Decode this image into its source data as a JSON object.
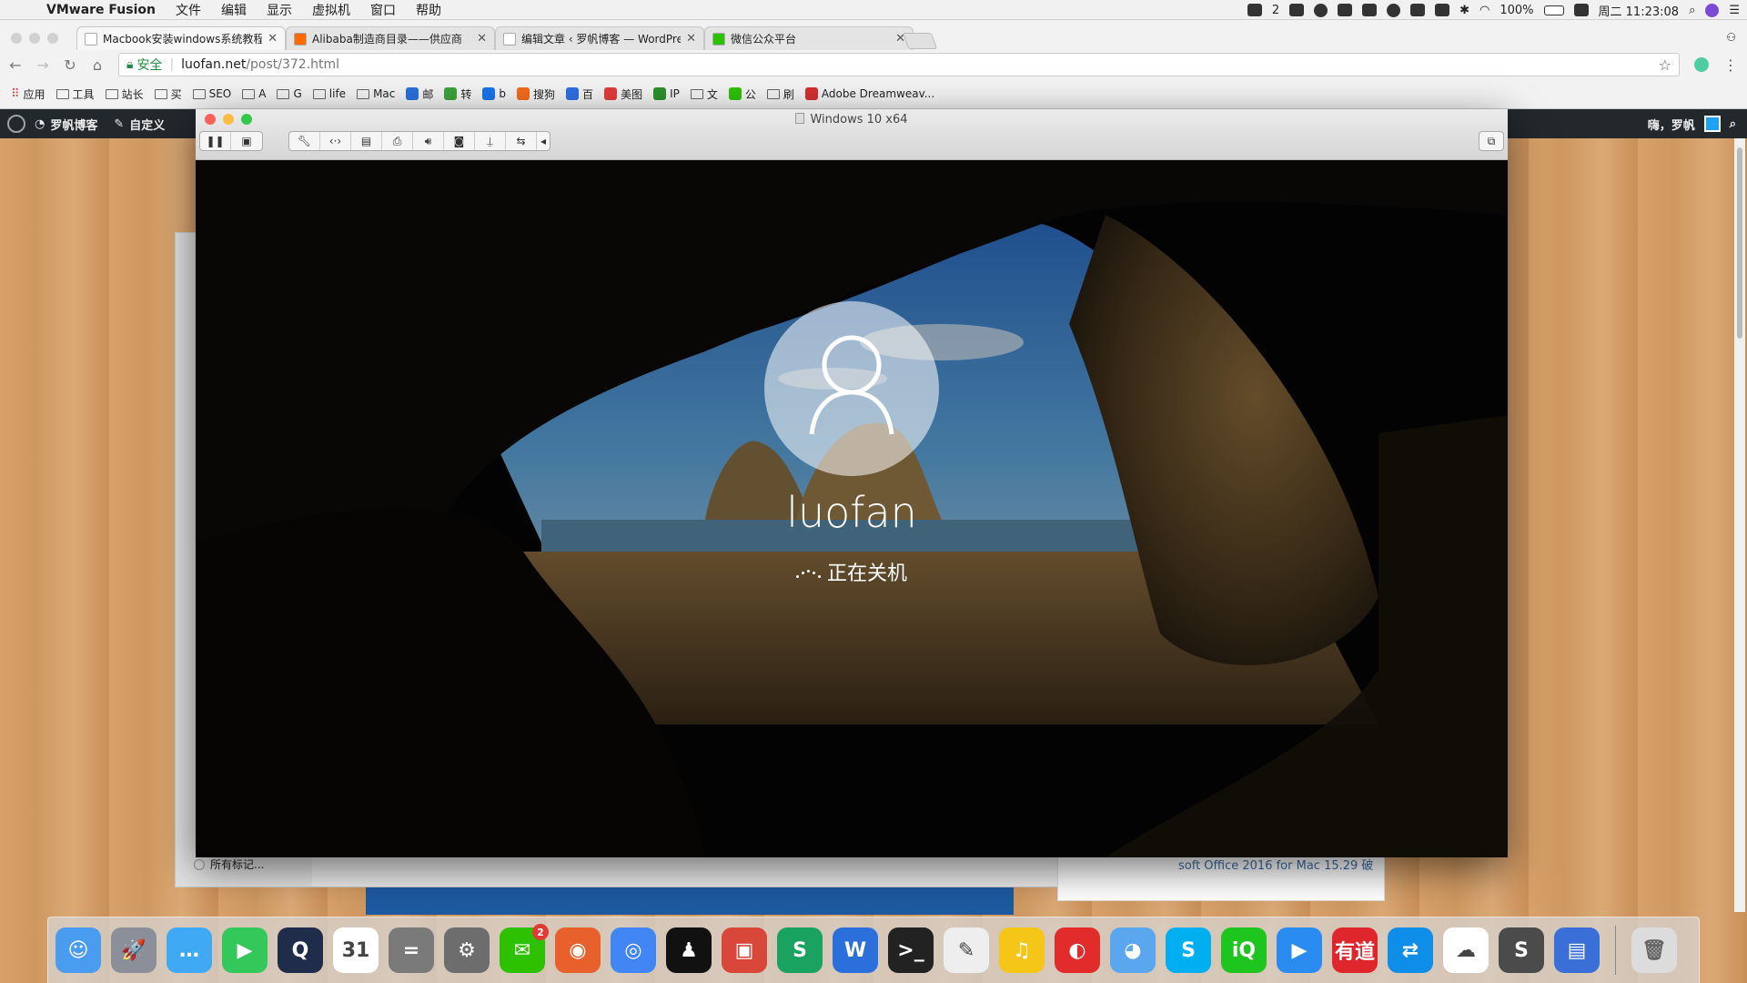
{
  "menubar": {
    "app": "VMware Fusion",
    "items": [
      "文件",
      "编辑",
      "显示",
      "虚拟机",
      "窗口",
      "帮助"
    ],
    "wechat_count": "2",
    "battery": "100%",
    "clock": "周二 11:23:08"
  },
  "browser": {
    "tabs": [
      {
        "title": "Macbook安装windows系统教程",
        "fav_color": "#ffffff",
        "active": true
      },
      {
        "title": "Alibaba制造商目录——供应商",
        "fav_color": "#ff6a00",
        "active": false
      },
      {
        "title": "编辑文章 ‹ 罗帆博客 — WordPress",
        "fav_color": "#ffffff",
        "active": false
      },
      {
        "title": "微信公众平台",
        "fav_color": "#2dc100",
        "active": false
      }
    ],
    "secure_label": "安全",
    "url_host": "luofan.net",
    "url_path": "/post/372.html",
    "bookmarks": [
      {
        "label": "应用",
        "kind": "apps"
      },
      {
        "label": "工具",
        "kind": "folder"
      },
      {
        "label": "站长",
        "kind": "folder"
      },
      {
        "label": "买",
        "kind": "folder"
      },
      {
        "label": "SEO",
        "kind": "folder"
      },
      {
        "label": "A",
        "kind": "folder"
      },
      {
        "label": "G",
        "kind": "folder"
      },
      {
        "label": "life",
        "kind": "folder"
      },
      {
        "label": "Mac",
        "kind": "folder"
      },
      {
        "label": "邮",
        "kind": "fav",
        "color": "#2a6fdb"
      },
      {
        "label": "转",
        "kind": "fav",
        "color": "#3aa33a"
      },
      {
        "label": "b",
        "kind": "fav",
        "color": "#1a73e8"
      },
      {
        "label": "搜狗",
        "kind": "fav",
        "color": "#f26b1d"
      },
      {
        "label": "百",
        "kind": "fav",
        "color": "#2f6fe4"
      },
      {
        "label": "美图",
        "kind": "fav",
        "color": "#e23b3b"
      },
      {
        "label": "IP",
        "kind": "fav",
        "color": "#2d8f2d"
      },
      {
        "label": "文",
        "kind": "folder"
      },
      {
        "label": "公",
        "kind": "fav",
        "color": "#2dc100"
      },
      {
        "label": "刷",
        "kind": "folder"
      },
      {
        "label": "Adobe Dreamweav...",
        "kind": "fav",
        "color": "#d32f2f"
      }
    ]
  },
  "wpbar": {
    "site": "罗帆博客",
    "customize": "自定义",
    "greeting": "嗨，罗帆"
  },
  "background": {
    "all_bookmarks": "所有标记...",
    "card_text": "soft Office 2016 for Mac 15.29 破"
  },
  "vm": {
    "window_title": "Windows 10 x64",
    "username": "luofan",
    "status": "正在关机"
  },
  "dock": {
    "apps": [
      {
        "name": "finder",
        "color": "#4a9cf0",
        "glyph": "☺"
      },
      {
        "name": "launchpad",
        "color": "#8a8f99",
        "glyph": "🚀"
      },
      {
        "name": "messages",
        "color": "#3fa9f5",
        "glyph": "…"
      },
      {
        "name": "facetime",
        "color": "#34c759",
        "glyph": "▶"
      },
      {
        "name": "quicktime",
        "color": "#1f2d4a",
        "glyph": "Q"
      },
      {
        "name": "calendar",
        "color": "#ffffff",
        "glyph": "31"
      },
      {
        "name": "calculator",
        "color": "#7a7a7a",
        "glyph": "="
      },
      {
        "name": "system-preferences",
        "color": "#6d6d6d",
        "glyph": "⚙"
      },
      {
        "name": "wechat",
        "color": "#2dc100",
        "glyph": "✉",
        "badge": "2"
      },
      {
        "name": "firefox",
        "color": "#e8612c",
        "glyph": "◉"
      },
      {
        "name": "chrome",
        "color": "#4285f4",
        "glyph": "◎"
      },
      {
        "name": "qq",
        "color": "#111111",
        "glyph": "♟"
      },
      {
        "name": "remote-desktop",
        "color": "#d9463a",
        "glyph": "▣"
      },
      {
        "name": "wps-sheets",
        "color": "#1aa260",
        "glyph": "S"
      },
      {
        "name": "wps-writer",
        "color": "#2a6fdb",
        "glyph": "W"
      },
      {
        "name": "terminal",
        "color": "#222222",
        "glyph": ">_"
      },
      {
        "name": "textedit",
        "color": "#eeeeee",
        "glyph": "✎"
      },
      {
        "name": "qq-music",
        "color": "#f5c518",
        "glyph": "♫"
      },
      {
        "name": "netease-music",
        "color": "#e22b2b",
        "glyph": "◐"
      },
      {
        "name": "qq-browser",
        "color": "#5aa7f0",
        "glyph": "◕"
      },
      {
        "name": "skype",
        "color": "#00aff0",
        "glyph": "S"
      },
      {
        "name": "iqiyi",
        "color": "#1ec51e",
        "glyph": "iQ"
      },
      {
        "name": "video-player",
        "color": "#2a8cf0",
        "glyph": "▶"
      },
      {
        "name": "youdao",
        "color": "#e0262d",
        "glyph": "有道"
      },
      {
        "name": "teamviewer",
        "color": "#0e8ee9",
        "glyph": "⇄"
      },
      {
        "name": "baidu-netdisk",
        "color": "#ffffff",
        "glyph": "☁"
      },
      {
        "name": "sublime-text",
        "color": "#4b4b4b",
        "glyph": "S"
      },
      {
        "name": "vmware-fusion",
        "color": "#3a6fd8",
        "glyph": "▤"
      }
    ],
    "trash": {
      "name": "trash",
      "color": "#dcdcdc",
      "glyph": "🗑"
    }
  }
}
